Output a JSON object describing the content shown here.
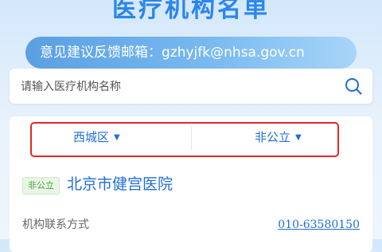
{
  "header": {
    "title": "医疗机构名单"
  },
  "feedback": {
    "text": "意见建议反馈邮箱：gzhyjfk@nhsa.gov.cn"
  },
  "search": {
    "placeholder": "请输入医疗机构名称",
    "icon": "search-icon"
  },
  "filters": {
    "district": "西城区",
    "type": "非公立",
    "caret": "▼"
  },
  "results": [
    {
      "badge": "非公立",
      "name": "北京市健宫医院",
      "contact_label": "机构联系方式",
      "phone": "010-63580150"
    }
  ],
  "colors": {
    "accent": "#1f6fd6",
    "title": "#2c85ea",
    "highlight": "#e02a22",
    "badge_bg": "#e9f6e6",
    "badge_text": "#4a9e44"
  }
}
